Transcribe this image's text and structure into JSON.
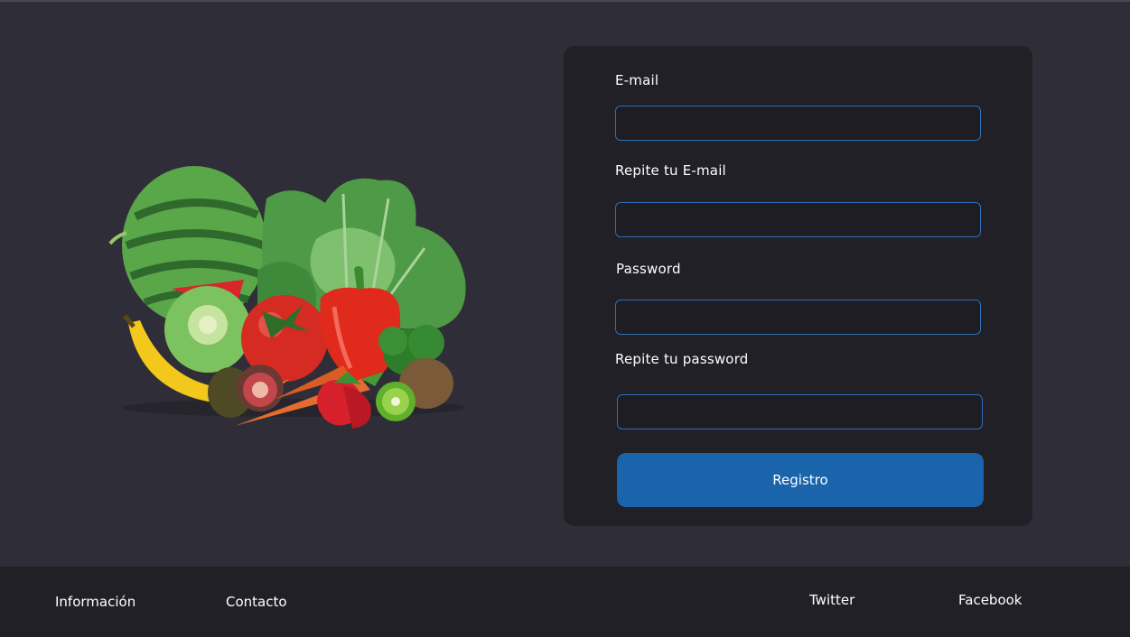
{
  "form": {
    "email_label": "E-mail",
    "email_value": "",
    "email_repeat_label": "Repite tu E-mail",
    "email_repeat_value": "",
    "password_label": "Password",
    "password_value": "",
    "password_repeat_label": "Repite tu password",
    "password_repeat_value": "",
    "submit_label": "Registro"
  },
  "footer": {
    "info_label": "Información",
    "contact_label": "Contacto",
    "twitter_label": "Twitter",
    "facebook_label": "Facebook"
  },
  "colors": {
    "page_background": "#2f2e38",
    "card_background": "#202026",
    "input_border": "#2f6fb8",
    "button_background": "#1a64ab",
    "footer_background": "#202026"
  }
}
